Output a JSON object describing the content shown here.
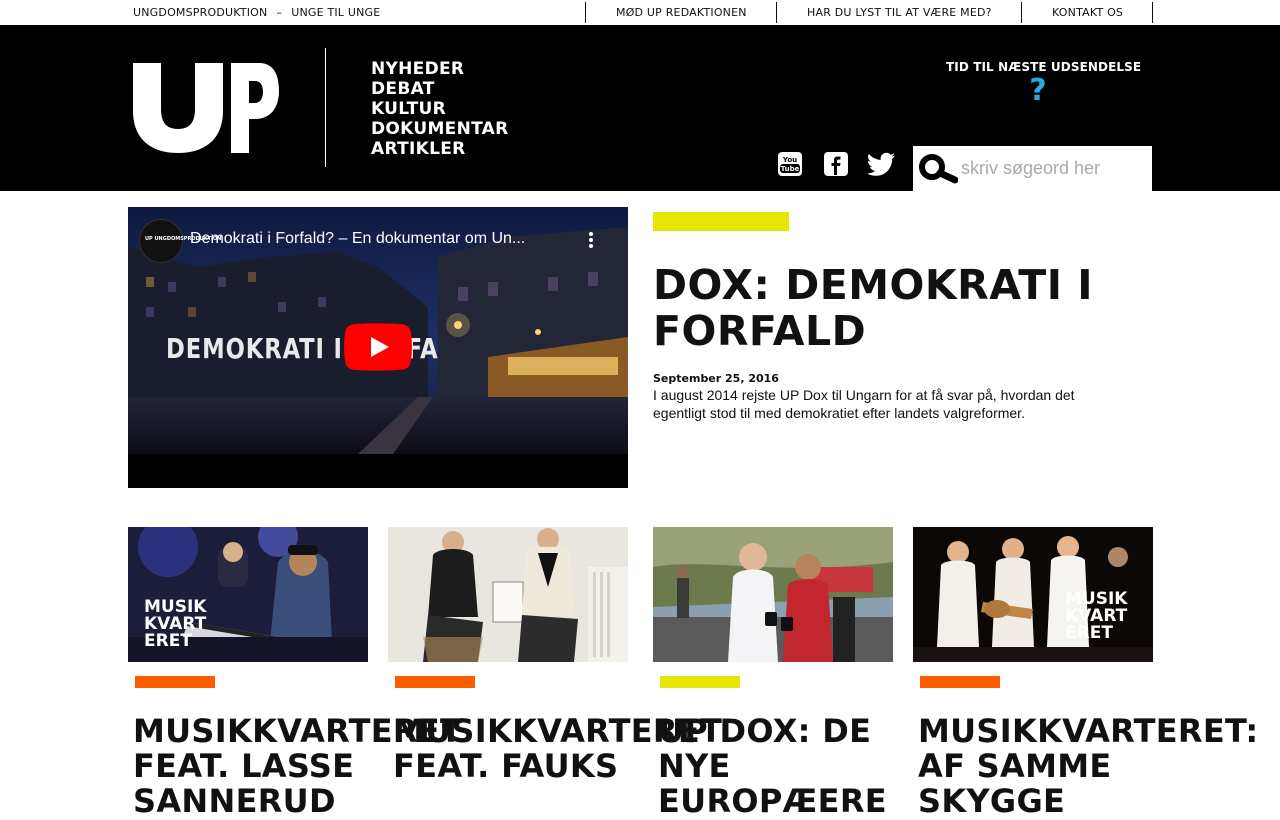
{
  "topbar": {
    "brand_left": "UNGDOMSPRODUKTION",
    "brand_sep": "–",
    "brand_right": "UNGE TIL UNGE",
    "links": [
      "MØD UP REDAKTIONEN",
      "HAR DU LYST TIL AT VÆRE MED?",
      "KONTAKT OS"
    ]
  },
  "header": {
    "logo_text": "UP",
    "nav": [
      "NYHEDER",
      "DEBAT",
      "KULTUR",
      "DOKUMENTAR",
      "ARTIKLER"
    ],
    "countdown_title": "TID TIL NÆSTE UDSENDELSE",
    "countdown_value": "?",
    "social": [
      {
        "icon": "youtube-icon",
        "label": "You Tube"
      },
      {
        "icon": "facebook-icon",
        "label": "f"
      },
      {
        "icon": "twitter-icon",
        "label": "twitter"
      }
    ],
    "search_placeholder": "skriv søgeord her"
  },
  "featured": {
    "video_title": "Demokrati i Forfald? – En dokumentar om Un...",
    "video_overlay": "DEMOKRATI I FORFA",
    "channel_label": "UP UNGDOMSPRODUKTION",
    "tag_color": "#e6e600",
    "title": "DOX: DEMOKRATI I FORFALD",
    "date": "September 25, 2016",
    "summary": "I august 2014 rejste UP Dox til Ungarn for at få svar på, hvordan det egentligt stod til med demokratiet efter landets valgreformer."
  },
  "cards": [
    {
      "title_line1": "MUSIKKVARTERET",
      "title_line2": "FEAT. LASSE",
      "title_line3": "SANNERUD",
      "tag_color": "#ff5c00",
      "thumb_label": "MUSIK KVART ERET"
    },
    {
      "title_line1": "MUSIKKVARTERET",
      "title_line2": "FEAT. FAUKS",
      "title_line3": "",
      "tag_color": "#ff5c00",
      "thumb_label": ""
    },
    {
      "title_line1": "UP DOX: DE",
      "title_line2": "NYE",
      "title_line3": "EUROPÆERE",
      "tag_color": "#e6e600",
      "thumb_label": ""
    },
    {
      "title_line1": "MUSIKKVARTERET:",
      "title_line2": "AF SAMME",
      "title_line3": "SKYGGE",
      "tag_color": "#ff5c00",
      "thumb_label": "MUSIK KVART ERET"
    }
  ],
  "colors": {
    "accent_yellow": "#e6e600",
    "accent_orange": "#ff5c00",
    "countdown_blue": "#29abe2"
  }
}
